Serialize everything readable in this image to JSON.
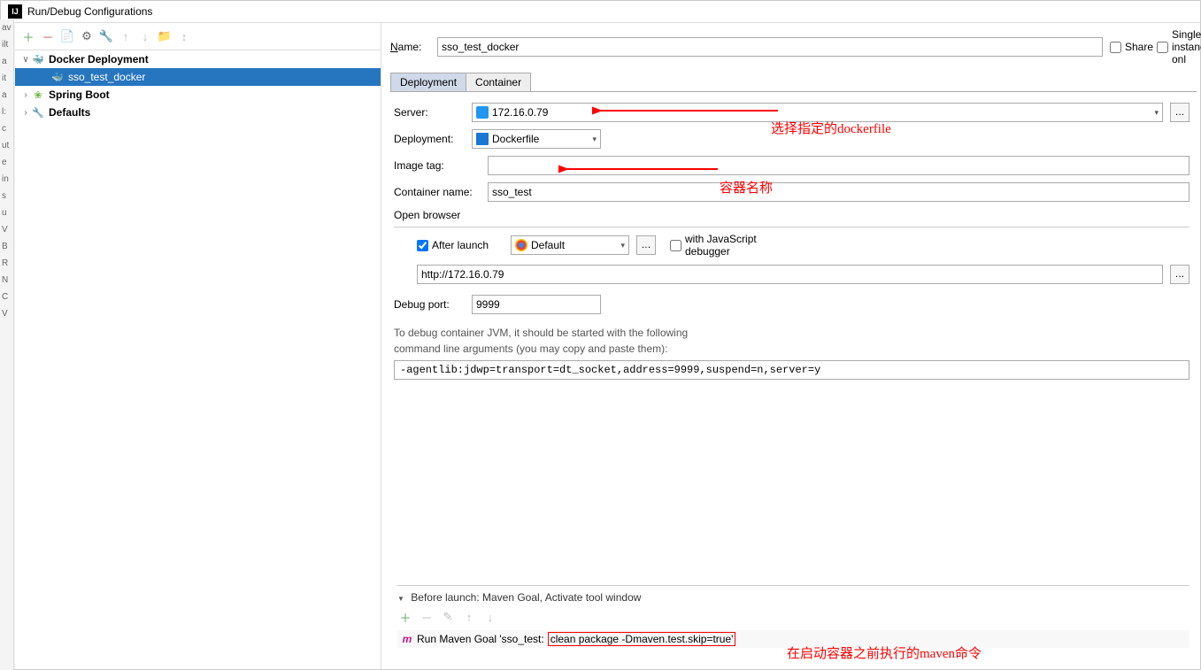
{
  "window": {
    "title": "Run/Debug Configurations"
  },
  "tree": {
    "root1": "Docker Deployment",
    "root1_child": "sso_test_docker",
    "root2": "Spring Boot",
    "root3": "Defaults"
  },
  "header": {
    "name_label": "Name:",
    "name_value": "sso_test_docker",
    "share": "Share",
    "single_instance": "Single instance onl"
  },
  "tabs": {
    "deployment": "Deployment",
    "container": "Container"
  },
  "form": {
    "server_label": "Server:",
    "server_value": "172.16.0.79",
    "deployment_label": "Deployment:",
    "deployment_value": "Dockerfile",
    "image_tag_label": "Image tag:",
    "image_tag_value": "",
    "container_name_label": "Container name:",
    "container_name_value": "sso_test",
    "open_browser": "Open browser",
    "after_launch": "After launch",
    "browser_value": "Default",
    "js_debugger": "with JavaScript debugger",
    "url_value": "http://172.16.0.79",
    "debug_port_label": "Debug port:",
    "debug_port_value": "9999",
    "debug_info1": "To debug container JVM, it should be started with the following",
    "debug_info2": "command line arguments (you may copy and paste them):",
    "jvm_args": "-agentlib:jdwp=transport=dt_socket,address=9999,suspend=n,server=y"
  },
  "before_launch": {
    "header": "Before launch: Maven Goal, Activate tool window",
    "item_prefix": "Run Maven Goal 'sso_test: ",
    "item_cmd": "clean package -Dmaven.test.skip=true'"
  },
  "annotations": {
    "a1": "选择指定的dockerfile",
    "a2": "容器名称",
    "a3": "在启动容器之前执行的maven命令"
  }
}
